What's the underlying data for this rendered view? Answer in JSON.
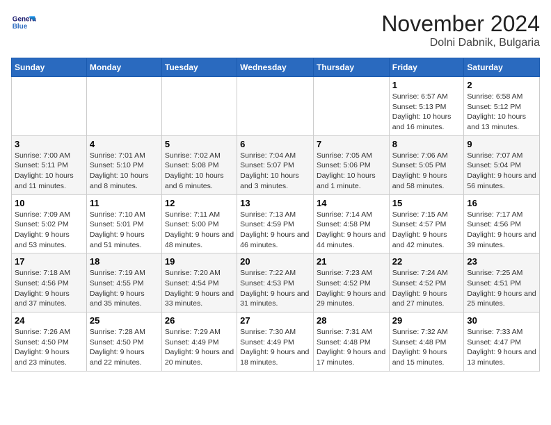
{
  "header": {
    "logo_line1": "General",
    "logo_line2": "Blue",
    "month": "November 2024",
    "location": "Dolni Dabnik, Bulgaria"
  },
  "days_of_week": [
    "Sunday",
    "Monday",
    "Tuesday",
    "Wednesday",
    "Thursday",
    "Friday",
    "Saturday"
  ],
  "weeks": [
    [
      {
        "day": "",
        "info": ""
      },
      {
        "day": "",
        "info": ""
      },
      {
        "day": "",
        "info": ""
      },
      {
        "day": "",
        "info": ""
      },
      {
        "day": "",
        "info": ""
      },
      {
        "day": "1",
        "info": "Sunrise: 6:57 AM\nSunset: 5:13 PM\nDaylight: 10 hours and 16 minutes."
      },
      {
        "day": "2",
        "info": "Sunrise: 6:58 AM\nSunset: 5:12 PM\nDaylight: 10 hours and 13 minutes."
      }
    ],
    [
      {
        "day": "3",
        "info": "Sunrise: 7:00 AM\nSunset: 5:11 PM\nDaylight: 10 hours and 11 minutes."
      },
      {
        "day": "4",
        "info": "Sunrise: 7:01 AM\nSunset: 5:10 PM\nDaylight: 10 hours and 8 minutes."
      },
      {
        "day": "5",
        "info": "Sunrise: 7:02 AM\nSunset: 5:08 PM\nDaylight: 10 hours and 6 minutes."
      },
      {
        "day": "6",
        "info": "Sunrise: 7:04 AM\nSunset: 5:07 PM\nDaylight: 10 hours and 3 minutes."
      },
      {
        "day": "7",
        "info": "Sunrise: 7:05 AM\nSunset: 5:06 PM\nDaylight: 10 hours and 1 minute."
      },
      {
        "day": "8",
        "info": "Sunrise: 7:06 AM\nSunset: 5:05 PM\nDaylight: 9 hours and 58 minutes."
      },
      {
        "day": "9",
        "info": "Sunrise: 7:07 AM\nSunset: 5:04 PM\nDaylight: 9 hours and 56 minutes."
      }
    ],
    [
      {
        "day": "10",
        "info": "Sunrise: 7:09 AM\nSunset: 5:02 PM\nDaylight: 9 hours and 53 minutes."
      },
      {
        "day": "11",
        "info": "Sunrise: 7:10 AM\nSunset: 5:01 PM\nDaylight: 9 hours and 51 minutes."
      },
      {
        "day": "12",
        "info": "Sunrise: 7:11 AM\nSunset: 5:00 PM\nDaylight: 9 hours and 48 minutes."
      },
      {
        "day": "13",
        "info": "Sunrise: 7:13 AM\nSunset: 4:59 PM\nDaylight: 9 hours and 46 minutes."
      },
      {
        "day": "14",
        "info": "Sunrise: 7:14 AM\nSunset: 4:58 PM\nDaylight: 9 hours and 44 minutes."
      },
      {
        "day": "15",
        "info": "Sunrise: 7:15 AM\nSunset: 4:57 PM\nDaylight: 9 hours and 42 minutes."
      },
      {
        "day": "16",
        "info": "Sunrise: 7:17 AM\nSunset: 4:56 PM\nDaylight: 9 hours and 39 minutes."
      }
    ],
    [
      {
        "day": "17",
        "info": "Sunrise: 7:18 AM\nSunset: 4:56 PM\nDaylight: 9 hours and 37 minutes."
      },
      {
        "day": "18",
        "info": "Sunrise: 7:19 AM\nSunset: 4:55 PM\nDaylight: 9 hours and 35 minutes."
      },
      {
        "day": "19",
        "info": "Sunrise: 7:20 AM\nSunset: 4:54 PM\nDaylight: 9 hours and 33 minutes."
      },
      {
        "day": "20",
        "info": "Sunrise: 7:22 AM\nSunset: 4:53 PM\nDaylight: 9 hours and 31 minutes."
      },
      {
        "day": "21",
        "info": "Sunrise: 7:23 AM\nSunset: 4:52 PM\nDaylight: 9 hours and 29 minutes."
      },
      {
        "day": "22",
        "info": "Sunrise: 7:24 AM\nSunset: 4:52 PM\nDaylight: 9 hours and 27 minutes."
      },
      {
        "day": "23",
        "info": "Sunrise: 7:25 AM\nSunset: 4:51 PM\nDaylight: 9 hours and 25 minutes."
      }
    ],
    [
      {
        "day": "24",
        "info": "Sunrise: 7:26 AM\nSunset: 4:50 PM\nDaylight: 9 hours and 23 minutes."
      },
      {
        "day": "25",
        "info": "Sunrise: 7:28 AM\nSunset: 4:50 PM\nDaylight: 9 hours and 22 minutes."
      },
      {
        "day": "26",
        "info": "Sunrise: 7:29 AM\nSunset: 4:49 PM\nDaylight: 9 hours and 20 minutes."
      },
      {
        "day": "27",
        "info": "Sunrise: 7:30 AM\nSunset: 4:49 PM\nDaylight: 9 hours and 18 minutes."
      },
      {
        "day": "28",
        "info": "Sunrise: 7:31 AM\nSunset: 4:48 PM\nDaylight: 9 hours and 17 minutes."
      },
      {
        "day": "29",
        "info": "Sunrise: 7:32 AM\nSunset: 4:48 PM\nDaylight: 9 hours and 15 minutes."
      },
      {
        "day": "30",
        "info": "Sunrise: 7:33 AM\nSunset: 4:47 PM\nDaylight: 9 hours and 13 minutes."
      }
    ]
  ]
}
